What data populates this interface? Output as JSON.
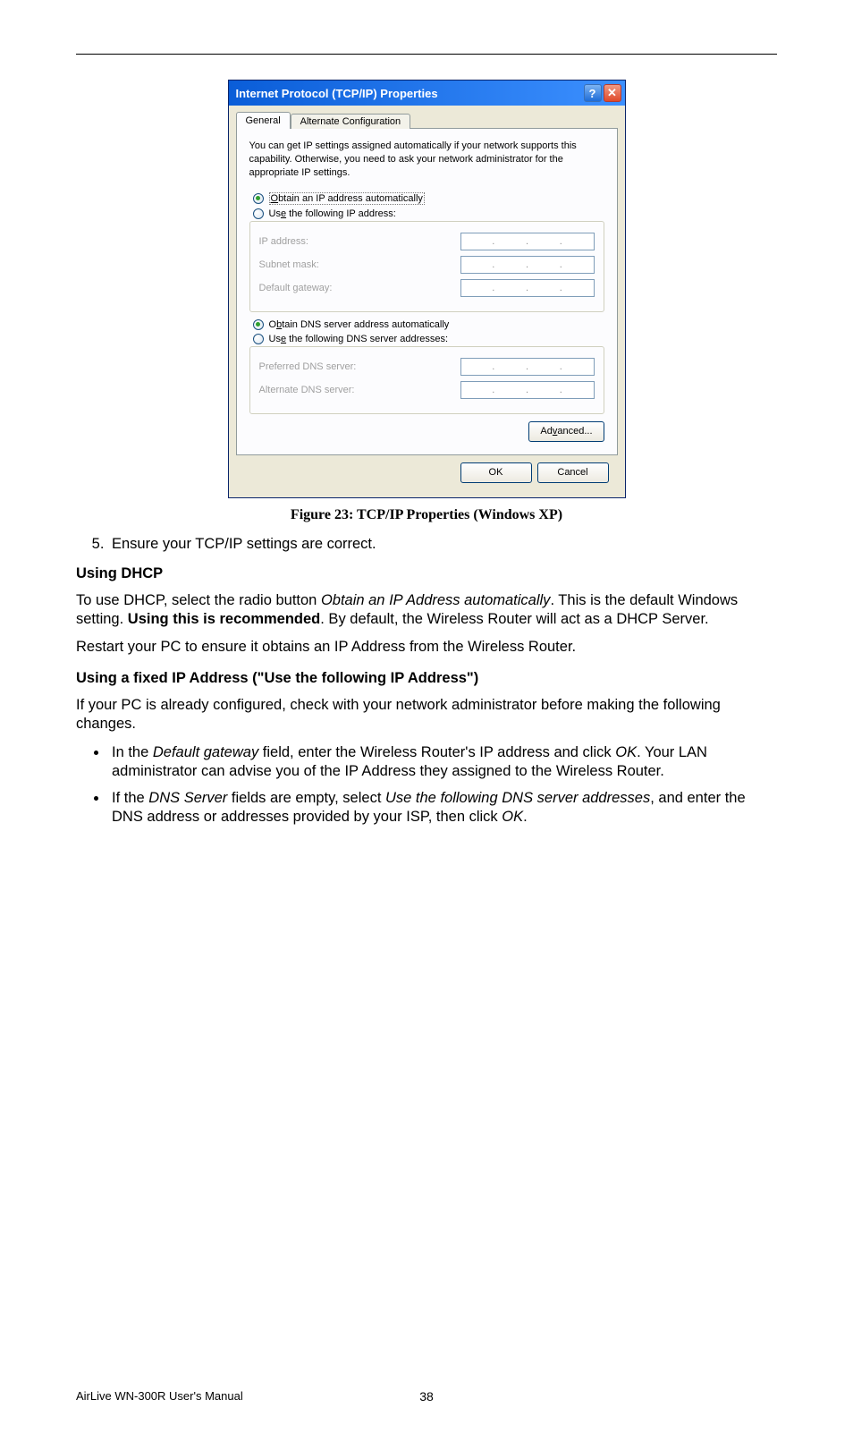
{
  "dialog": {
    "title": "Internet Protocol (TCP/IP) Properties",
    "tabs": {
      "general": "General",
      "alternate": "Alternate Configuration"
    },
    "desc": "You can get IP settings assigned automatically if your network supports this capability. Otherwise, you need to ask your network administrator for the appropriate IP settings.",
    "radio": {
      "obtain_ip_pre": "O",
      "obtain_ip_rest": "btain an IP address automatically",
      "use_ip_pre": "Us",
      "use_ip_u": "e",
      "use_ip_rest": " the following IP address:",
      "obtain_dns_pre": "O",
      "obtain_dns_u": "b",
      "obtain_dns_rest": "tain DNS server address automatically",
      "use_dns_pre": "Us",
      "use_dns_u": "e",
      "use_dns_rest": " the following DNS server addresses:"
    },
    "fields": {
      "ip": "IP address:",
      "subnet": "Subnet mask:",
      "gateway": "Default gateway:",
      "pref_dns": "Preferred DNS server:",
      "alt_dns": "Alternate DNS server:"
    },
    "buttons": {
      "advanced_pre": "Ad",
      "advanced_u": "v",
      "advanced_rest": "anced...",
      "ok": "OK",
      "cancel": "Cancel"
    }
  },
  "caption": "Figure 23: TCP/IP Properties (Windows XP)",
  "step5": "Ensure your TCP/IP settings are correct.",
  "using_dhcp_heading": "Using DHCP",
  "dhcp_p1_a": "To use DHCP, select the radio button ",
  "dhcp_p1_i": "Obtain an IP Address automatically",
  "dhcp_p1_b": ". This is the default Windows setting. ",
  "dhcp_p1_bold": "Using this is recommended",
  "dhcp_p1_c": ". By default, the Wireless Router will act as a DHCP Server.",
  "dhcp_p2": "Restart your PC to ensure it obtains an IP Address from the Wireless Router.",
  "fixed_heading": "Using a fixed IP Address (\"Use the following IP Address\")",
  "fixed_p1": "If your PC is already configured, check with your network administrator before making the following changes.",
  "bul1_a": "In the ",
  "bul1_i1": "Default gateway",
  "bul1_b": " field, enter the Wireless Router's IP address and click ",
  "bul1_i2": "OK",
  "bul1_c": ". Your LAN administrator can advise you of the IP Address they assigned to the Wireless Router.",
  "bul2_a": "If the ",
  "bul2_i1": "DNS Server",
  "bul2_b": " fields are empty, select ",
  "bul2_i2": "Use the following DNS server addresses",
  "bul2_c": ", and enter the DNS address or addresses provided by your ISP, then click ",
  "bul2_i3": "OK",
  "bul2_d": ".",
  "footer_left": "AirLive WN-300R User's Manual",
  "page_number": "38"
}
